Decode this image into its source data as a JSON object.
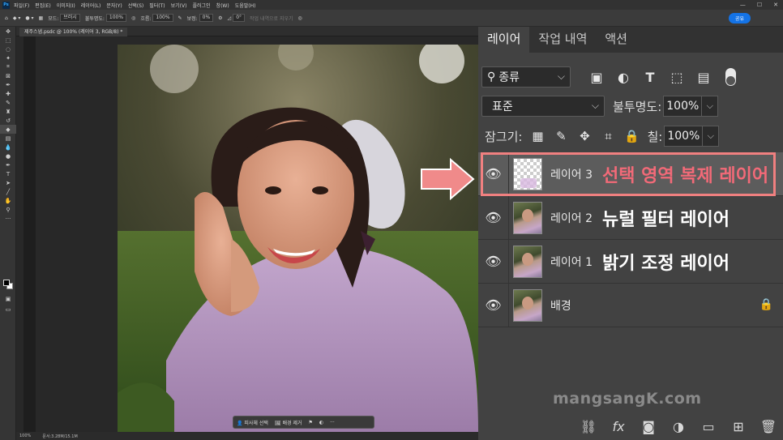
{
  "app": {
    "logo": "Ps",
    "menu": [
      "파일(F)",
      "편집(E)",
      "이미지(I)",
      "레이어(L)",
      "문자(Y)",
      "선택(S)",
      "필터(T)",
      "보기(V)",
      "플러그인",
      "창(W)",
      "도움말(H)"
    ],
    "window_controls": [
      "—",
      "☐",
      "✕"
    ]
  },
  "options_bar": {
    "mode_label": "모드:",
    "mode_value": "브러시",
    "opacity_label": "불투명도:",
    "opacity_value": "100%",
    "flow_label": "흐름:",
    "flow_value": "100%",
    "smoothing_label": "보정:",
    "smoothing_value": "0%",
    "angle_value": "0°",
    "erase_history": "작업 내역으로 지우기",
    "share_label": "공유"
  },
  "document": {
    "tab_title": "제주스냅.psdc @ 100% (레이어 3, RGB/8) *",
    "zoom": "100%",
    "doc_size": "문서:3.28M/15.1M"
  },
  "context_bar": {
    "select_subject": "피사체 선택",
    "remove_bg": "배경 제거",
    "more": "···"
  },
  "panel": {
    "tabs": [
      "레이어",
      "작업 내역",
      "액션"
    ],
    "active_tab": 0,
    "kind_label": "종류",
    "blend_mode": "표준",
    "opacity_label": "불투명도:",
    "opacity_value": "100%",
    "lock_label": "잠그기:",
    "fill_label": "칠:",
    "fill_value": "100%",
    "layers": [
      {
        "name": "레이어 3",
        "note": "선택 영역 복제 레이어",
        "selected": true,
        "thumb": "transparent"
      },
      {
        "name": "레이어 2",
        "note": "뉴럴 필터 레이어",
        "selected": false,
        "thumb": "photo"
      },
      {
        "name": "레이어 1",
        "note": "밝기 조정 레이어",
        "selected": false,
        "thumb": "photo"
      },
      {
        "name": "배경",
        "note": "",
        "selected": false,
        "thumb": "photo",
        "locked": true
      }
    ]
  },
  "watermark": "mangsangK.com",
  "colors": {
    "accent": "#1473e6",
    "highlight": "#f08080",
    "note_selected": "#f26a78",
    "arrow": "#f08a8a"
  },
  "icons": {
    "filter": [
      "image-icon",
      "adjustment-icon",
      "type-icon",
      "shape-icon",
      "smart-object-icon"
    ],
    "lock": [
      "lock-pixels-icon",
      "lock-paint-icon",
      "lock-position-icon",
      "lock-artboard-icon",
      "lock-all-icon"
    ],
    "footer": [
      "link-icon",
      "fx-icon",
      "mask-icon",
      "adjustment-layer-icon",
      "group-icon",
      "new-layer-icon",
      "trash-icon"
    ]
  }
}
